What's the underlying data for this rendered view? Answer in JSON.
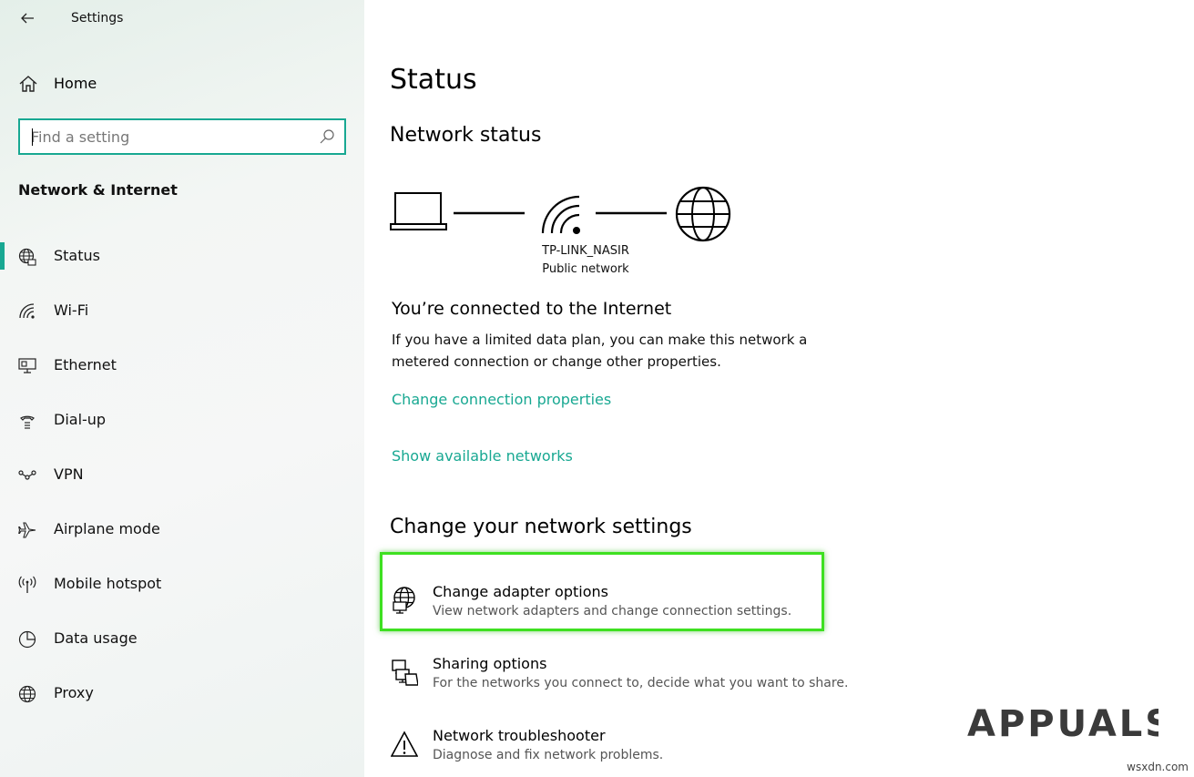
{
  "app": {
    "title": "Settings"
  },
  "sidebar": {
    "home_label": "Home",
    "search": {
      "placeholder": "Find a setting",
      "value": ""
    },
    "section_title": "Network & Internet",
    "items": [
      {
        "label": "Status",
        "icon": "globe-status-icon",
        "active": true
      },
      {
        "label": "Wi-Fi",
        "icon": "wifi-icon",
        "active": false
      },
      {
        "label": "Ethernet",
        "icon": "ethernet-icon",
        "active": false
      },
      {
        "label": "Dial-up",
        "icon": "dialup-icon",
        "active": false
      },
      {
        "label": "VPN",
        "icon": "vpn-icon",
        "active": false
      },
      {
        "label": "Airplane mode",
        "icon": "airplane-icon",
        "active": false
      },
      {
        "label": "Mobile hotspot",
        "icon": "hotspot-icon",
        "active": false
      },
      {
        "label": "Data usage",
        "icon": "data-usage-icon",
        "active": false
      },
      {
        "label": "Proxy",
        "icon": "proxy-globe-icon",
        "active": false
      }
    ]
  },
  "main": {
    "title": "Status",
    "network_status_title": "Network status",
    "network": {
      "name": "TP-LINK_NASIR",
      "type": "Public network"
    },
    "connected_title": "You’re connected to the Internet",
    "connected_desc": "If you have a limited data plan, you can make this network a metered connection or change other properties.",
    "links": {
      "change_properties": "Change connection properties",
      "show_networks": "Show available networks"
    },
    "change_settings_title": "Change your network settings",
    "options": [
      {
        "title": "Change adapter options",
        "desc": "View network adapters and change connection settings.",
        "icon": "adapter-icon"
      },
      {
        "title": "Sharing options",
        "desc": "For the networks you connect to, decide what you want to share.",
        "icon": "sharing-icon"
      },
      {
        "title": "Network troubleshooter",
        "desc": "Diagnose and fix network problems.",
        "icon": "warning-icon"
      }
    ]
  },
  "watermark": {
    "logo_text": "APPUALS",
    "site": "wsxdn.com"
  },
  "colors": {
    "accent": "#18a892",
    "highlight": "#3ee021"
  }
}
